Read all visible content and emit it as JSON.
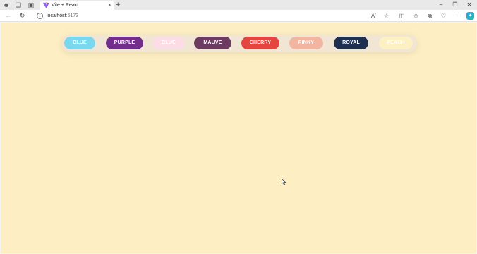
{
  "browser": {
    "tab_title": "Vite + React",
    "url_host": "localhost",
    "url_port": ":5173",
    "icons": {
      "profile": "profile-icon",
      "workspaces": "workspaces-icon",
      "tab_actions": "tab-actions-icon",
      "close_tab": "close-icon",
      "new_tab": "plus-icon",
      "minimize": "minimize-icon",
      "maximize": "maximize-icon",
      "close_window": "close-window-icon",
      "back": "back-arrow-icon",
      "refresh": "refresh-icon",
      "info": "info-icon",
      "read_aloud": "read-aloud-icon",
      "favorite": "star-icon",
      "split_screen": "split-screen-icon",
      "favorites": "favorites-icon",
      "collections": "collections-icon",
      "browser_essentials": "heart-pulse-icon",
      "more": "more-icon",
      "copilot": "copilot-icon"
    }
  },
  "page": {
    "background": "#fdefc3",
    "buttons": [
      {
        "label": "BLUE",
        "bg": "#79d8ee",
        "fg": "#ffffff"
      },
      {
        "label": "PURPLE",
        "bg": "#712e8a",
        "fg": "#ffffff"
      },
      {
        "label": "BLUE",
        "bg": "#fcdde5",
        "fg": "#ffffff"
      },
      {
        "label": "MAUVE",
        "bg": "#6b3c60",
        "fg": "#ffffff"
      },
      {
        "label": "CHERRY",
        "bg": "#e5453f",
        "fg": "#ffffff"
      },
      {
        "label": "PINKY",
        "bg": "#f2b5a1",
        "fg": "#ffffff"
      },
      {
        "label": "ROYAL",
        "bg": "#1f2f4f",
        "fg": "#ffffff"
      },
      {
        "label": "PEACH",
        "bg": "#fdf0c2",
        "fg": "#ffffff"
      }
    ]
  }
}
